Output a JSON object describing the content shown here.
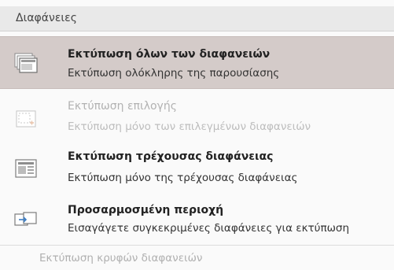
{
  "header": {
    "title": "Διαφάνειες"
  },
  "options": [
    {
      "title": "Εκτύπωση όλων των διαφανειών",
      "subtitle": "Εκτύπωση ολόκληρης της παρουσίασης",
      "icon": "all-slides-icon",
      "selected": true,
      "enabled": true
    },
    {
      "title": "Εκτύπωση επιλογής",
      "subtitle": "Εκτύπωση μόνο των επιλεγμένων διαφανειών",
      "icon": "selection-icon",
      "selected": false,
      "enabled": false
    },
    {
      "title": "Εκτύπωση τρέχουσας διαφάνειας",
      "subtitle": "Εκτύπωση μόνο της τρέχουσας διαφάνειας",
      "icon": "current-slide-icon",
      "selected": false,
      "enabled": true
    },
    {
      "title": "Προσαρμοσμένη περιοχή",
      "subtitle": "Εισαγάγετε συγκεκριμένες διαφάνειες για εκτύπωση",
      "icon": "custom-range-icon",
      "selected": false,
      "enabled": true
    }
  ],
  "hidden_slides": {
    "label": "Εκτύπωση κρυφών διαφανειών",
    "enabled": false
  },
  "colors": {
    "selected_bg": "#d4cbc9",
    "header_bg": "#e9e9e9",
    "disabled_text": "#b2b2b2",
    "icon_orange": "#e07a3a"
  }
}
